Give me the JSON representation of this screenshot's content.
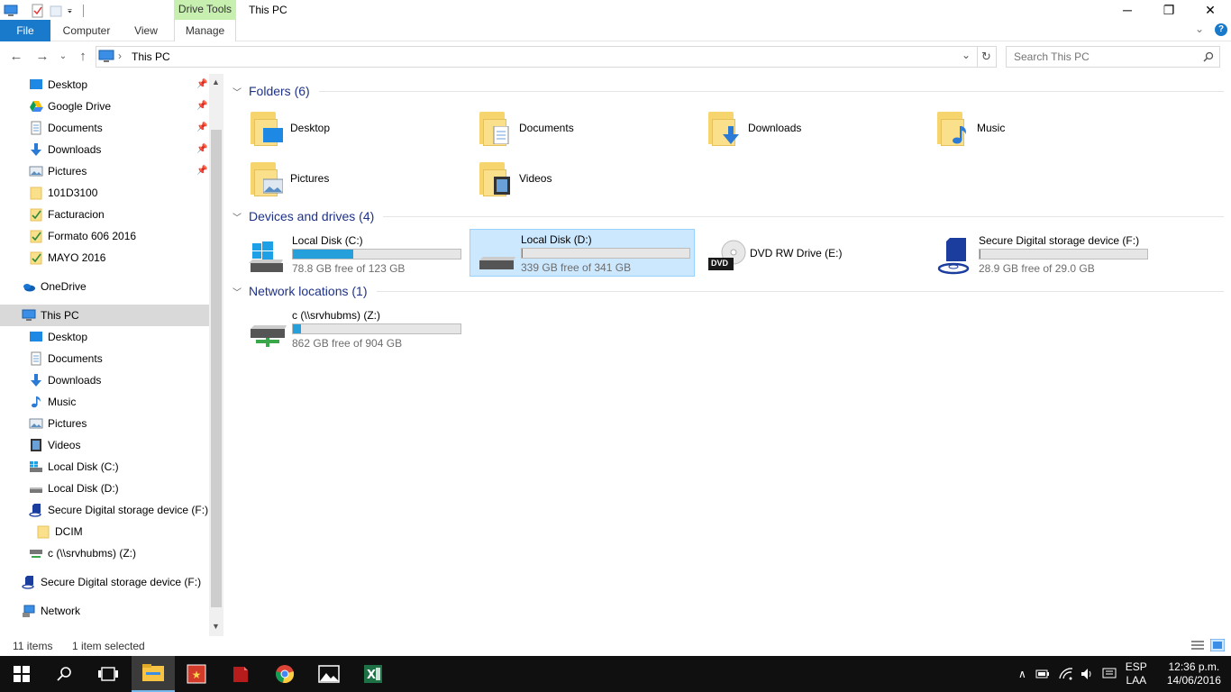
{
  "window": {
    "title": "This PC",
    "context_tab": "Drive Tools",
    "minimize": "─",
    "maximize": "❐",
    "close": "✕"
  },
  "ribbon": {
    "tabs": [
      "File",
      "Computer",
      "View",
      "Manage"
    ],
    "expand": "⌄",
    "help": "?"
  },
  "address": {
    "path": "This PC",
    "sep": "›",
    "back": "←",
    "forward": "→",
    "recent": "⌄",
    "up": "↑",
    "dropdown": "⌄",
    "refresh": "↻",
    "search_placeholder": "Search This PC"
  },
  "nav": {
    "quick_access": [
      {
        "label": "Desktop",
        "icon": "desktop-icon",
        "pinned": true
      },
      {
        "label": "Google Drive",
        "icon": "google-drive-icon",
        "pinned": true
      },
      {
        "label": "Documents",
        "icon": "documents-icon",
        "pinned": true
      },
      {
        "label": "Downloads",
        "icon": "downloads-icon",
        "pinned": true
      },
      {
        "label": "Pictures",
        "icon": "pictures-icon",
        "pinned": true
      },
      {
        "label": "101D3100",
        "icon": "folder-icon",
        "pinned": false
      },
      {
        "label": "Facturacion",
        "icon": "shortcut-folder-icon",
        "pinned": false
      },
      {
        "label": "Formato 606 2016",
        "icon": "shortcut-folder-icon",
        "pinned": false
      },
      {
        "label": "MAYO 2016",
        "icon": "shortcut-folder-icon",
        "pinned": false
      }
    ],
    "onedrive": "OneDrive",
    "this_pc": "This PC",
    "this_pc_items": [
      {
        "label": "Desktop",
        "icon": "desktop-icon"
      },
      {
        "label": "Documents",
        "icon": "documents-icon"
      },
      {
        "label": "Downloads",
        "icon": "downloads-icon"
      },
      {
        "label": "Music",
        "icon": "music-icon"
      },
      {
        "label": "Pictures",
        "icon": "pictures-icon"
      },
      {
        "label": "Videos",
        "icon": "videos-icon"
      },
      {
        "label": "Local Disk (C:)",
        "icon": "windows-drive-icon"
      },
      {
        "label": "Local Disk (D:)",
        "icon": "drive-icon"
      },
      {
        "label": "Secure Digital storage device (F:)",
        "icon": "sd-card-icon"
      }
    ],
    "dcim": "DCIM",
    "network_drive": "c (\\\\srvhubms) (Z:)",
    "sd_root": "Secure Digital storage device (F:)",
    "network": "Network"
  },
  "groups": {
    "folders": "Folders (6)",
    "devices": "Devices and drives (4)",
    "network": "Network locations (1)"
  },
  "folders": [
    "Desktop",
    "Documents",
    "Downloads",
    "Music",
    "Pictures",
    "Videos"
  ],
  "drives": [
    {
      "name": "Local Disk (C:)",
      "free": "78.8 GB free of 123 GB",
      "used_fraction": 0.36
    },
    {
      "name": "Local Disk (D:)",
      "free": "339 GB free of 341 GB",
      "used_fraction": 0.006
    },
    {
      "name": "DVD RW Drive (E:)",
      "dvd_label": "DVD"
    },
    {
      "name": "Secure Digital storage device (F:)",
      "free": "28.9 GB free of 29.0 GB",
      "used_fraction": 0.003
    }
  ],
  "network_location": {
    "name": "c (\\\\srvhubms) (Z:)",
    "free": "862 GB free of 904 GB",
    "used_fraction": 0.046
  },
  "status": {
    "items": "11 items",
    "selected": "1 item selected"
  },
  "taskbar": {
    "lang_top": "ESP",
    "lang_bottom": "LAA",
    "time": "12:36 p.m.",
    "date": "14/06/2016"
  },
  "colors": {
    "accent": "#1979ca",
    "selection": "#cce8ff",
    "bar_fill": "#26a0da",
    "header": "#1e3287"
  }
}
